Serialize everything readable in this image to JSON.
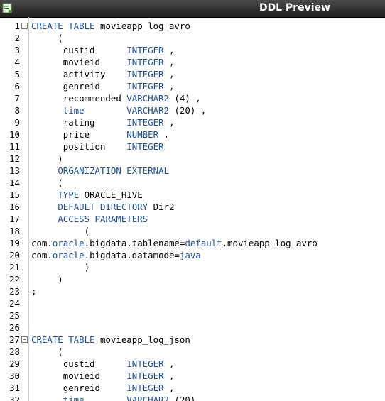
{
  "window": {
    "title": "DDL Preview",
    "icon": "ddl-preview-icon"
  },
  "colors": {
    "keyword": "#1d4fa3",
    "text": "#000000",
    "titlebar": "#2a2a2a"
  },
  "lines": [
    {
      "n": "1",
      "fold": true,
      "t": [
        [
          "CREATE TABLE",
          "k"
        ],
        [
          " movieapp_log_avro",
          ""
        ]
      ]
    },
    {
      "n": "2",
      "t": [
        [
          "     (",
          ""
        ]
      ]
    },
    {
      "n": "3",
      "t": [
        [
          "      custid      ",
          ""
        ],
        [
          "INTEGER",
          "k"
        ],
        [
          " ,",
          ""
        ]
      ]
    },
    {
      "n": "4",
      "t": [
        [
          "      movieid     ",
          ""
        ],
        [
          "INTEGER",
          "k"
        ],
        [
          " ,",
          ""
        ]
      ]
    },
    {
      "n": "5",
      "t": [
        [
          "      activity    ",
          ""
        ],
        [
          "INTEGER",
          "k"
        ],
        [
          " ,",
          ""
        ]
      ]
    },
    {
      "n": "6",
      "t": [
        [
          "      genreid     ",
          ""
        ],
        [
          "INTEGER",
          "k"
        ],
        [
          " ,",
          ""
        ]
      ]
    },
    {
      "n": "7",
      "t": [
        [
          "      recommended ",
          ""
        ],
        [
          "VARCHAR2",
          "k"
        ],
        [
          " (4) ,",
          ""
        ]
      ]
    },
    {
      "n": "8",
      "t": [
        [
          "      ",
          ""
        ],
        [
          "time",
          "k"
        ],
        [
          "        ",
          ""
        ],
        [
          "VARCHAR2",
          "k"
        ],
        [
          " (20) ,",
          ""
        ]
      ]
    },
    {
      "n": "9",
      "t": [
        [
          "      rating      ",
          ""
        ],
        [
          "INTEGER",
          "k"
        ],
        [
          " ,",
          ""
        ]
      ]
    },
    {
      "n": "10",
      "t": [
        [
          "      price       ",
          ""
        ],
        [
          "NUMBER",
          "k"
        ],
        [
          " ,",
          ""
        ]
      ]
    },
    {
      "n": "11",
      "t": [
        [
          "      position    ",
          ""
        ],
        [
          "INTEGER",
          "k"
        ]
      ]
    },
    {
      "n": "12",
      "t": [
        [
          "     )",
          ""
        ]
      ]
    },
    {
      "n": "13",
      "t": [
        [
          "     ",
          ""
        ],
        [
          "ORGANIZATION EXTERNAL",
          "k"
        ]
      ]
    },
    {
      "n": "14",
      "t": [
        [
          "     (",
          ""
        ]
      ]
    },
    {
      "n": "15",
      "t": [
        [
          "     ",
          ""
        ],
        [
          "TYPE",
          "k"
        ],
        [
          " ORACLE_HIVE",
          ""
        ]
      ]
    },
    {
      "n": "16",
      "t": [
        [
          "     ",
          ""
        ],
        [
          "DEFAULT DIRECTORY",
          "k"
        ],
        [
          " Dir2",
          ""
        ]
      ]
    },
    {
      "n": "17",
      "t": [
        [
          "     ",
          ""
        ],
        [
          "ACCESS PARAMETERS",
          "k"
        ]
      ]
    },
    {
      "n": "18",
      "t": [
        [
          "          (",
          ""
        ]
      ]
    },
    {
      "n": "19",
      "t": [
        [
          "com.",
          ""
        ],
        [
          "oracle",
          "k"
        ],
        [
          ".bigdata.tablename=",
          ""
        ],
        [
          "default",
          "k"
        ],
        [
          ".movieapp_log_avro",
          ""
        ]
      ]
    },
    {
      "n": "20",
      "t": [
        [
          "com.",
          ""
        ],
        [
          "oracle",
          "k"
        ],
        [
          ".bigdata.datamode=",
          ""
        ],
        [
          "java",
          "k"
        ]
      ]
    },
    {
      "n": "21",
      "t": [
        [
          "          )",
          ""
        ]
      ]
    },
    {
      "n": "22",
      "t": [
        [
          "     )",
          ""
        ]
      ]
    },
    {
      "n": "23",
      "t": [
        [
          ";",
          ""
        ]
      ]
    },
    {
      "n": "24",
      "t": []
    },
    {
      "n": "25",
      "t": []
    },
    {
      "n": "26",
      "t": []
    },
    {
      "n": "27",
      "fold": true,
      "t": [
        [
          "CREATE TABLE",
          "k"
        ],
        [
          " movieapp_log_json",
          ""
        ]
      ]
    },
    {
      "n": "28",
      "t": [
        [
          "     (",
          ""
        ]
      ]
    },
    {
      "n": "29",
      "t": [
        [
          "      custid      ",
          ""
        ],
        [
          "INTEGER",
          "k"
        ],
        [
          " ,",
          ""
        ]
      ]
    },
    {
      "n": "30",
      "t": [
        [
          "      movieid     ",
          ""
        ],
        [
          "INTEGER",
          "k"
        ],
        [
          " ,",
          ""
        ]
      ]
    },
    {
      "n": "31",
      "t": [
        [
          "      genreid     ",
          ""
        ],
        [
          "INTEGER",
          "k"
        ],
        [
          " ,",
          ""
        ]
      ]
    },
    {
      "n": "32",
      "t": [
        [
          "      ",
          ""
        ],
        [
          "time",
          "k"
        ],
        [
          "        ",
          ""
        ],
        [
          "VARCHAR2",
          "k"
        ],
        [
          " (20)",
          ""
        ]
      ]
    }
  ]
}
